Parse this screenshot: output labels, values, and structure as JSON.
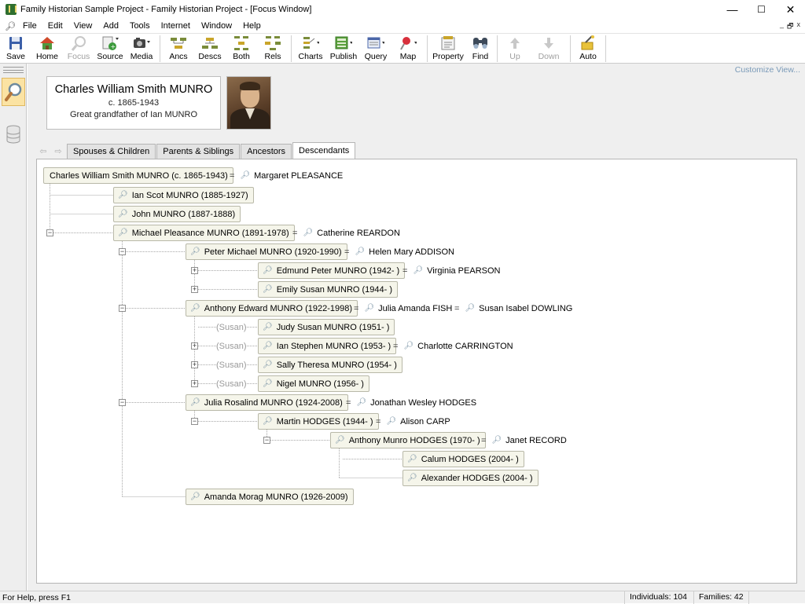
{
  "window": {
    "title": "Family Historian Sample Project - Family Historian Project - [Focus Window]",
    "minimize": "—",
    "maximize": "☐",
    "close": "✕"
  },
  "menu": [
    "File",
    "Edit",
    "View",
    "Add",
    "Tools",
    "Internet",
    "Window",
    "Help"
  ],
  "mdi_controls": [
    "_",
    "🗗",
    "x"
  ],
  "toolbar": [
    {
      "label": "Save",
      "icon": "save-icon",
      "enabled": true
    },
    {
      "label": "Home",
      "icon": "home-icon",
      "enabled": true
    },
    {
      "label": "Focus",
      "icon": "focus-icon",
      "enabled": false
    },
    {
      "label": "Source",
      "icon": "source-icon",
      "enabled": true
    },
    {
      "label": "Media",
      "icon": "media-icon",
      "enabled": true
    },
    {
      "label": "Ancs",
      "icon": "ancestors-icon",
      "enabled": true
    },
    {
      "label": "Descs",
      "icon": "descendants-icon",
      "enabled": true
    },
    {
      "label": "Both",
      "icon": "both-icon",
      "enabled": true
    },
    {
      "label": "Rels",
      "icon": "relatives-icon",
      "enabled": true
    },
    {
      "label": "Charts",
      "icon": "charts-icon",
      "enabled": true
    },
    {
      "label": "Publish",
      "icon": "publish-icon",
      "enabled": true
    },
    {
      "label": "Query",
      "icon": "query-icon",
      "enabled": true
    },
    {
      "label": "Map",
      "icon": "map-icon",
      "enabled": true
    },
    {
      "label": "Property",
      "icon": "property-icon",
      "enabled": true
    },
    {
      "label": "Find",
      "icon": "find-icon",
      "enabled": true
    },
    {
      "label": "Up",
      "icon": "up-arrow-icon",
      "enabled": false
    },
    {
      "label": "Down",
      "icon": "down-arrow-icon",
      "enabled": false
    },
    {
      "label": "Auto",
      "icon": "auto-icon",
      "enabled": true
    }
  ],
  "customize_link": "Customize View...",
  "focus_person": {
    "name": "Charles William Smith MUNRO",
    "dates": "c. 1865-1943",
    "relationship": "Great grandfather of  Ian MUNRO"
  },
  "tabs": [
    "Spouses & Children",
    "Parents & Siblings",
    "Ancestors",
    "Descendants"
  ],
  "active_tab": "Descendants",
  "tree": {
    "root": {
      "label": "Charles William Smith MUNRO (c. 1865-1943)",
      "spouses": [
        "Margaret PLEASANCE"
      ]
    },
    "nodes": [
      {
        "id": "ian",
        "label": "Ian Scot MUNRO (1885-1927)",
        "spouses": []
      },
      {
        "id": "john",
        "label": "John MUNRO (1887-1888)",
        "spouses": []
      },
      {
        "id": "michael",
        "label": "Michael Pleasance MUNRO (1891-1978)",
        "spouses": [
          "Catherine REARDON"
        ]
      },
      {
        "id": "peter",
        "label": "Peter Michael MUNRO (1920-1990)",
        "spouses": [
          "Helen Mary ADDISON"
        ]
      },
      {
        "id": "edmund",
        "label": "Edmund Peter MUNRO (1942- )",
        "spouses": [
          "Virginia PEARSON"
        ]
      },
      {
        "id": "emily",
        "label": "Emily Susan MUNRO (1944- )",
        "spouses": []
      },
      {
        "id": "anthony",
        "label": "Anthony Edward MUNRO (1922-1998)",
        "spouses": [
          "Julia Amanda FISH",
          "Susan Isabel DOWLING"
        ]
      },
      {
        "id": "judy",
        "label": "Judy Susan MUNRO (1951- )",
        "spouses": [],
        "parent_tag": "(Susan)"
      },
      {
        "id": "ianstephen",
        "label": "Ian Stephen MUNRO (1953- )",
        "spouses": [
          "Charlotte CARRINGTON"
        ],
        "parent_tag": "(Susan)"
      },
      {
        "id": "sally",
        "label": "Sally Theresa MUNRO (1954- )",
        "spouses": [],
        "parent_tag": "(Susan)"
      },
      {
        "id": "nigel",
        "label": "Nigel MUNRO (1956- )",
        "spouses": [],
        "parent_tag": "(Susan)"
      },
      {
        "id": "julia",
        "label": "Julia Rosalind MUNRO (1924-2008)",
        "spouses": [
          "Jonathan Wesley HODGES"
        ]
      },
      {
        "id": "martin",
        "label": "Martin HODGES (1944- )",
        "spouses": [
          "Alison CARP"
        ]
      },
      {
        "id": "anthonyh",
        "label": "Anthony Munro HODGES (1970- )",
        "spouses": [
          "Janet RECORD"
        ]
      },
      {
        "id": "calum",
        "label": "Calum HODGES (2004- )",
        "spouses": []
      },
      {
        "id": "alexander",
        "label": "Alexander HODGES (2004- )",
        "spouses": []
      },
      {
        "id": "amanda",
        "label": "Amanda Morag MUNRO (1926-2009)",
        "spouses": []
      }
    ],
    "expander_collapse": "−",
    "expander_expand": "+"
  },
  "status": {
    "help": "For Help, press F1",
    "individuals": "Individuals: 104",
    "families": "Families: 42"
  }
}
